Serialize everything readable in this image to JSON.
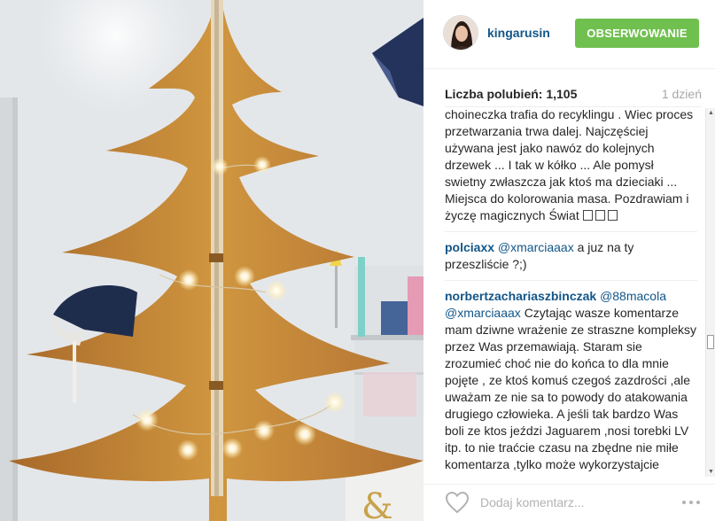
{
  "post": {
    "username": "kingarusin",
    "follow_label": "OBSERWOWANIE",
    "likes_text": "Liczba polubień: 1,105",
    "time_text": "1 dzień",
    "photo_icon": "cardboard-christmas-tree-photo",
    "avatar_icon": "profile-photo"
  },
  "comments": [
    {
      "user": "",
      "mention": "",
      "text": "choineczka trafia do recyklingu . Wiec proces przetwarzania trwa dalej. Najczęściej używana jest jako nawóz do kolejnych drzewek ... I tak w kółko ... Ale pomysł swietny zwłaszcza jak ktoś ma dzieciaki ... Miejsca do kolorowania masa. Pozdrawiam i życzę magicznych Świat"
    },
    {
      "user": "polciaxx",
      "mention": "@xmarciaaax",
      "text": "a juz na ty przeszliście ?;)"
    },
    {
      "user": "norbertzachariaszbinczak",
      "mention": "@88macola @xmarciaaax",
      "text": "Czytając wasze komentarze mam dziwne wrażenie ze straszne kompleksy przez Was przemawiają. Staram sie zrozumieć choć nie do końca to dla mnie pojęte , ze ktoś komuś czegoś zazdrości ,ale uważam ze nie sa to powody do atakowania drugiego człowieka. A jeśli tak bardzo Was boli ze ktos jeździ Jaguarem ,nosi torebki LV itp. to nie traćcie czasu na zbędne nie miłe komentarza ,tylko może wykorzystajcie"
    }
  ],
  "footer": {
    "comment_placeholder": "Dodaj komentarz...",
    "heart_icon": "heart-outline-icon",
    "more_icon": "more-options-icon"
  },
  "colors": {
    "follow_button": "#70c050",
    "username": "#125688",
    "time": "#a5a7aa",
    "tree": "#c98a3a"
  }
}
